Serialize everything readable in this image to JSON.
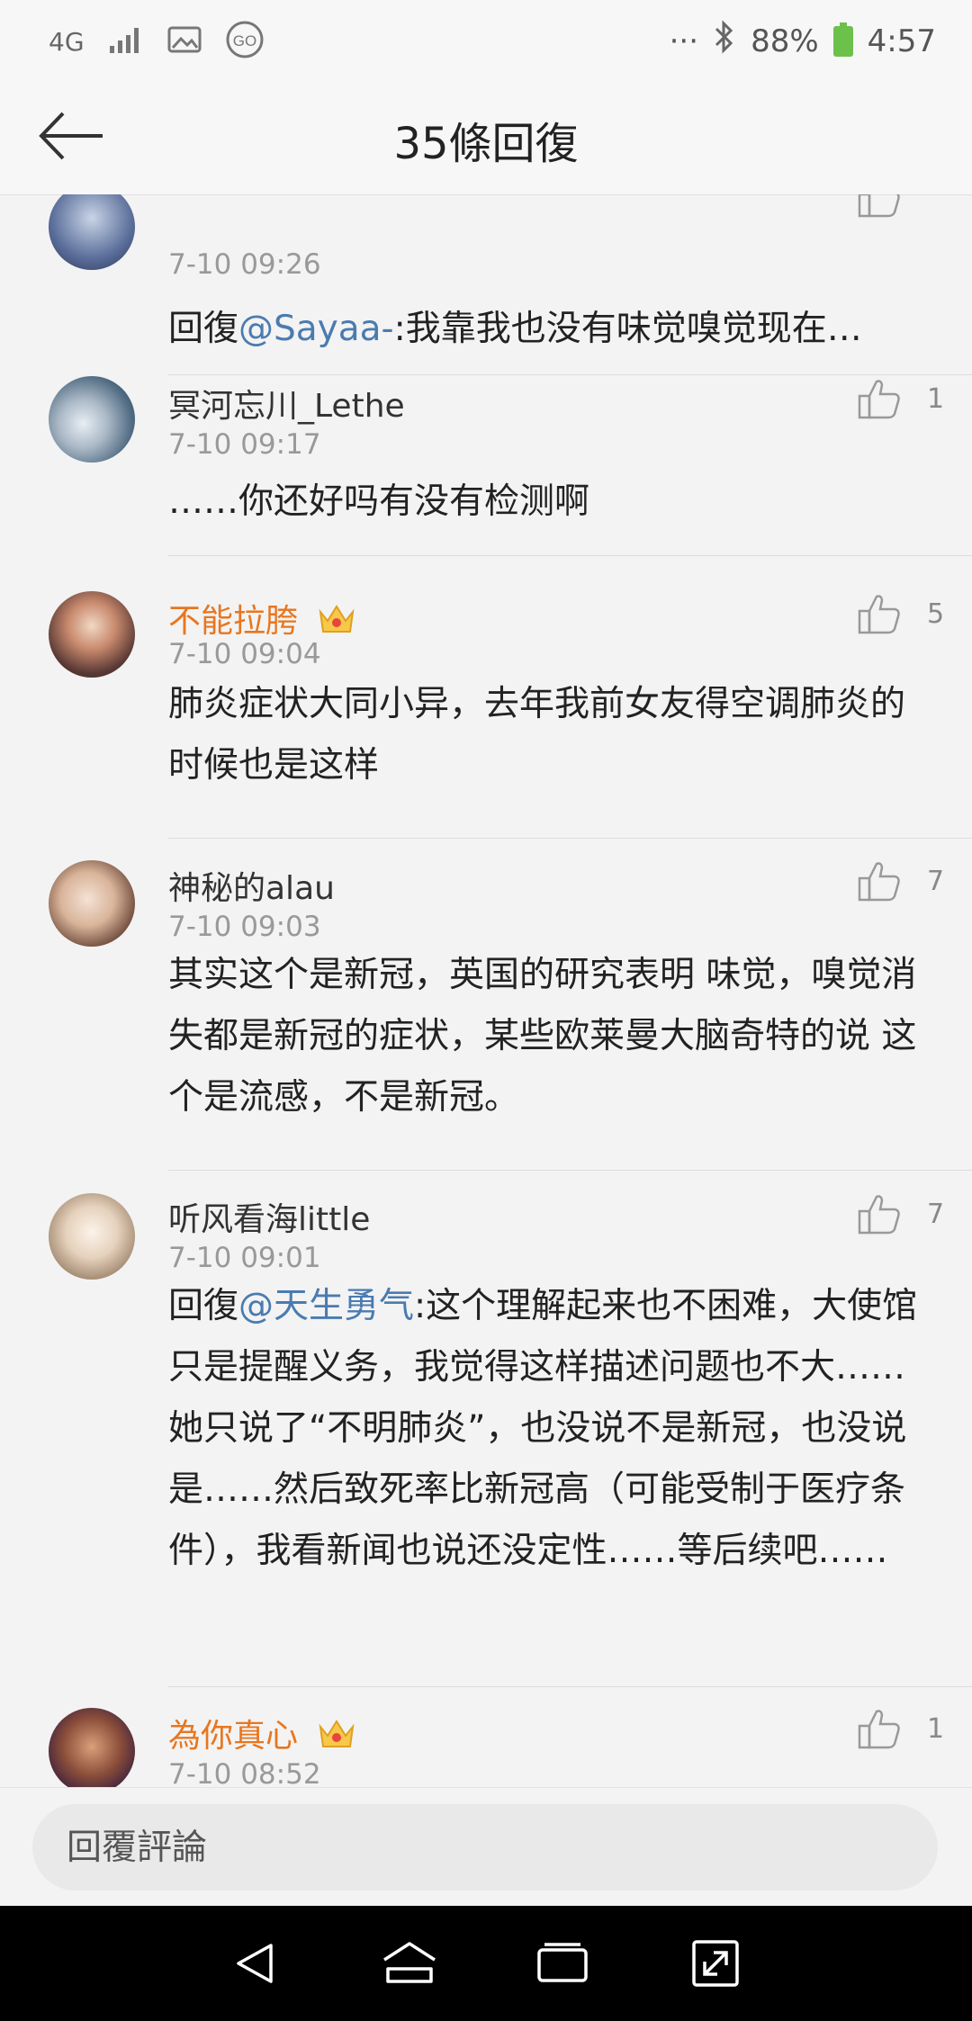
{
  "status_bar": {
    "network": "4G",
    "battery_percent": "88%",
    "time": "4:57",
    "more": "···"
  },
  "header": {
    "title": "35條回復"
  },
  "comments": [
    {
      "username": "",
      "time": "7-10 09:26",
      "likes": "",
      "prefix": "回復",
      "mention": "@Sayaa-",
      "text": ":我靠我也没有味觉嗅觉现在…"
    },
    {
      "username": "冥河忘川_Lethe",
      "time": "7-10 09:17",
      "likes": "1",
      "text": "……你还好吗有没有检测啊"
    },
    {
      "username": "不能拉胯",
      "vip": true,
      "time": "7-10 09:04",
      "likes": "5",
      "text": "肺炎症状大同小异，去年我前女友得空调肺炎的时候也是这样"
    },
    {
      "username": "神秘的alau",
      "time": "7-10 09:03",
      "likes": "7",
      "text": "其实这个是新冠，英国的研究表明 味觉，嗅觉消失都是新冠的症状，某些欧莱曼大脑奇特的说 这个是流感，不是新冠。"
    },
    {
      "username": "听风看海little",
      "time": "7-10 09:01",
      "likes": "7",
      "prefix": "回復",
      "mention": "@天生勇气",
      "text": ":这个理解起来也不困难，大使馆只是提醒义务，我觉得这样描述问题也不大……她只说了“不明肺炎”，也没说不是新冠，也没说是……然后致死率比新冠高（可能受制于医疗条件），我看新闻也说还没定性……等后续吧……"
    },
    {
      "username": "為你真心",
      "vip": true,
      "time": "7-10 08:52",
      "likes": "1",
      "text": ""
    }
  ],
  "reply_bar": {
    "placeholder": "回覆評論"
  },
  "colors": {
    "vip_name": "#e8761f",
    "mention": "#4a7bb0",
    "battery": "#6cc14a"
  },
  "icons": [
    "back-arrow-icon",
    "thumbs-up-icon",
    "crown-icon",
    "bluetooth-icon",
    "signal-icon",
    "image-icon",
    "go-icon",
    "nav-back-icon",
    "nav-home-icon",
    "nav-recents-icon",
    "nav-expand-icon"
  ]
}
